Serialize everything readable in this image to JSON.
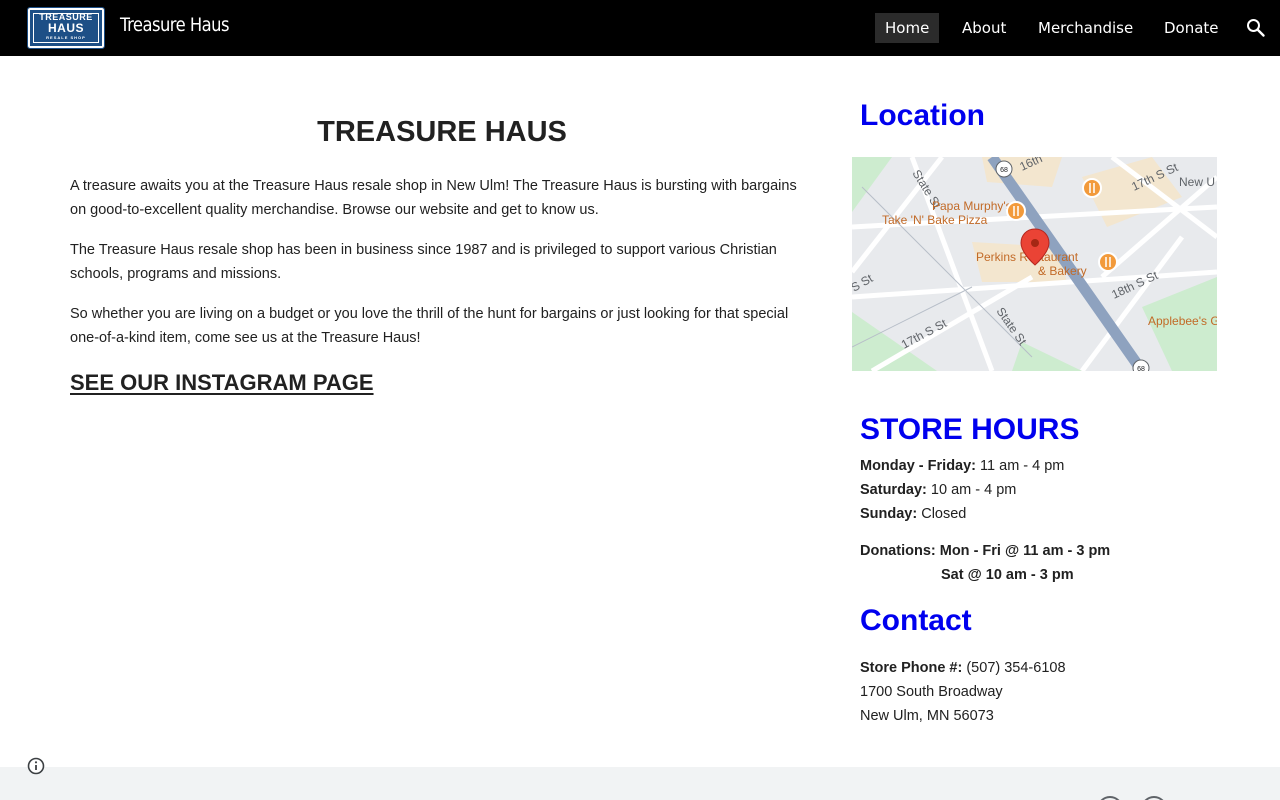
{
  "header": {
    "logo": {
      "line1": "TREASURE",
      "line2": "HAUS",
      "line3": "RESALE SHOP"
    },
    "site_title": "Treasure Haus",
    "nav": [
      {
        "label": "Home",
        "active": true
      },
      {
        "label": "About",
        "active": false
      },
      {
        "label": "Merchandise",
        "active": false
      },
      {
        "label": "Donate",
        "active": false
      }
    ],
    "search_icon": "search-icon"
  },
  "main": {
    "title": "TREASURE HAUS",
    "paragraphs": [
      "A treasure awaits you at the Treasure Haus resale shop in New Ulm! The Treasure Haus is bursting with bargains on good-to-excellent quality merchandise. Browse our website and get to know us.",
      "The Treasure Haus resale shop has been in business since 1987 and is privileged to support various Christian schools, programs and missions.",
      "So whether you are living on a budget or you love the thrill of the hunt for bargains or just looking for that special one-of-a-kind item, come see us at the Treasure Haus!"
    ],
    "instagram_link": "SEE OUR INSTAGRAM PAGE"
  },
  "sidebar": {
    "location_heading": "Location",
    "map": {
      "labels": {
        "sixteenth": "16th",
        "seventeenth_ne": "17th S St",
        "new_ulm": "New U",
        "state_st_top": "State St",
        "papa_murphys": "Papa Murphy's |",
        "take_n_bake": "Take 'N' Bake Pizza",
        "perkins": "Perkins Restaurant",
        "bakery": "& Bakery",
        "eighteenth": "18th S St",
        "s_st": "S St",
        "state_st_bottom": "State St",
        "seventeenth_sw": "17th S St",
        "applebees": "Applebee's G",
        "route": "68"
      }
    },
    "hours_heading": "STORE HOURS",
    "hours": {
      "weekday_label": "Monday - Friday:",
      "weekday_value": " 11 am - 4 pm",
      "saturday_label": "Saturday:",
      "saturday_value": " 10 am - 4 pm",
      "sunday_label": "Sunday:",
      "sunday_value": " Closed",
      "donations_label": "Donations:",
      "donations_value": " Mon - Fri @ 11 am - 3 pm",
      "donations_sat": "Sat @ 10 am - 3 pm"
    },
    "contact_heading": "Contact",
    "contact": {
      "phone_label": "Store Phone #:",
      "phone_value": " (507) 354-6108",
      "address1": "1700 South Broadway",
      "address2": "New Ulm, MN 56073"
    }
  },
  "colors": {
    "header_bg": "#000000",
    "accent_blue": "#0000ee",
    "logo_blue": "#1d4f86",
    "footer_bg": "#f1f3f4"
  }
}
